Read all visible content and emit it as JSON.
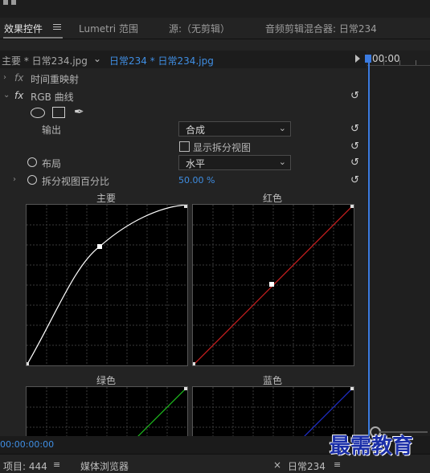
{
  "tabs": [
    {
      "label": "效果控件",
      "active": true
    },
    {
      "label": "Lumetri 范围"
    },
    {
      "label": "源:（无剪辑）"
    },
    {
      "label": "音频剪辑混合器: 日常234"
    }
  ],
  "clip_bar": {
    "source_label": "主要 * 日常234.jpg",
    "sequence_label": "日常234 * 日常234.jpg"
  },
  "timeline": {
    "timecode": "00:00",
    "playhead_timecode": "00:00:00:00"
  },
  "effects": {
    "time_remap_label": "时间重映射",
    "rgb_curves_label": "RGB 曲线",
    "fx_symbol": "fx",
    "output_label": "输出",
    "output_value": "合成",
    "show_split_label": "显示拆分视图",
    "layout_label": "布局",
    "layout_value": "水平",
    "split_percent_label": "拆分视图百分比",
    "split_percent_value": "50.00 %"
  },
  "curves": {
    "master_label": "主要",
    "red_label": "红色",
    "green_label": "绿色",
    "blue_label": "蓝色"
  },
  "bottom": {
    "project_label": "项目: 444",
    "media_browser_label": "媒体浏览器",
    "sequence_tab_label": "日常234"
  },
  "watermark_text": "最需教育",
  "colors": {
    "accent_blue": "#3f8ee3",
    "curve_master": "#ffffff",
    "curve_red": "#cc1f1f",
    "curve_green": "#1fbf1f",
    "curve_blue": "#1f2fcc",
    "watermark": "#1a2ea8"
  }
}
